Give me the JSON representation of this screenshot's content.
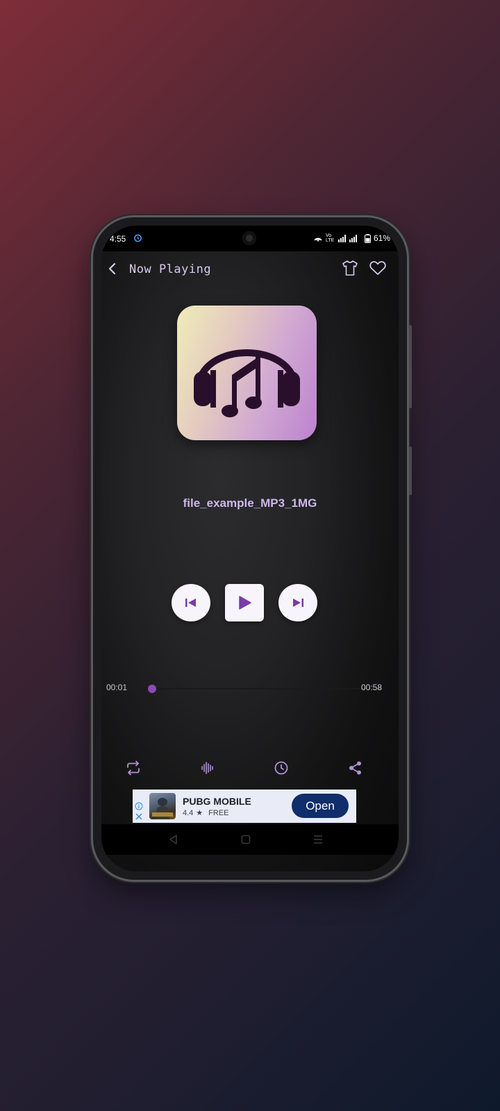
{
  "status_bar": {
    "time": "4:55",
    "network_label": "Vo LTE",
    "battery": "61%"
  },
  "header": {
    "title": "Now Playing"
  },
  "track": {
    "title": "file_example_MP3_1MG",
    "elapsed": "00:01",
    "duration": "00:58",
    "progress_fraction": 0.02
  },
  "icons": {
    "back": "chevron-left-icon",
    "theme": "tshirt-icon",
    "favorite": "heart-icon",
    "previous": "skip-previous-icon",
    "play": "play-icon",
    "next": "skip-next-icon",
    "repeat": "repeat-icon",
    "equalizer": "waveform-icon",
    "timer": "clock-icon",
    "share": "share-icon"
  },
  "ad": {
    "app_name": "PUBG MOBILE",
    "rating": "4.4",
    "price": "FREE",
    "cta": "Open"
  },
  "colors": {
    "accent": "#8a4bb8",
    "title_text": "#cdb7ec",
    "header_text": "#d8c9ee",
    "ad_button": "#0f2e6b"
  }
}
